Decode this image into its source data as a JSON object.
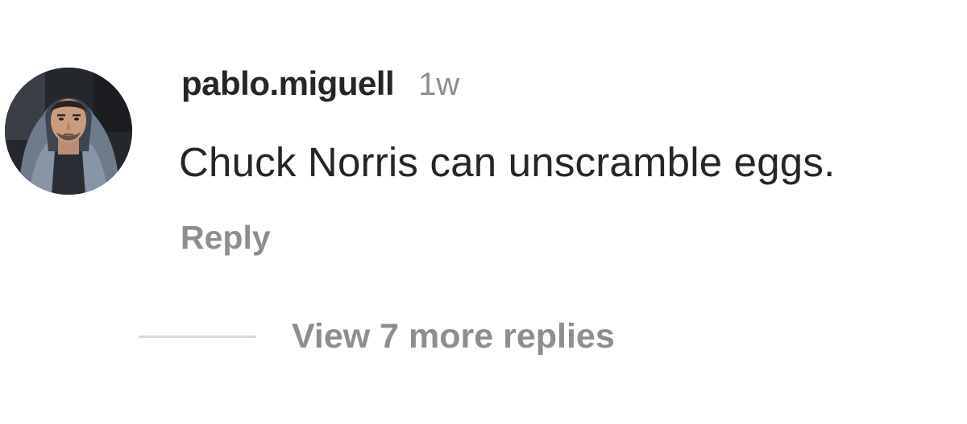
{
  "comment": {
    "avatar_alt": "pablo.miguell profile picture",
    "username": "pablo.miguell",
    "timestamp": "1w",
    "text": "Chuck Norris can unscramble eggs.",
    "reply_label": "Reply"
  },
  "replies": {
    "view_more_label": "View 7 more replies"
  },
  "colors": {
    "primary_text": "#262626",
    "secondary_text": "#8e8e8e",
    "divider": "#d9d9d9",
    "background": "#ffffff"
  }
}
